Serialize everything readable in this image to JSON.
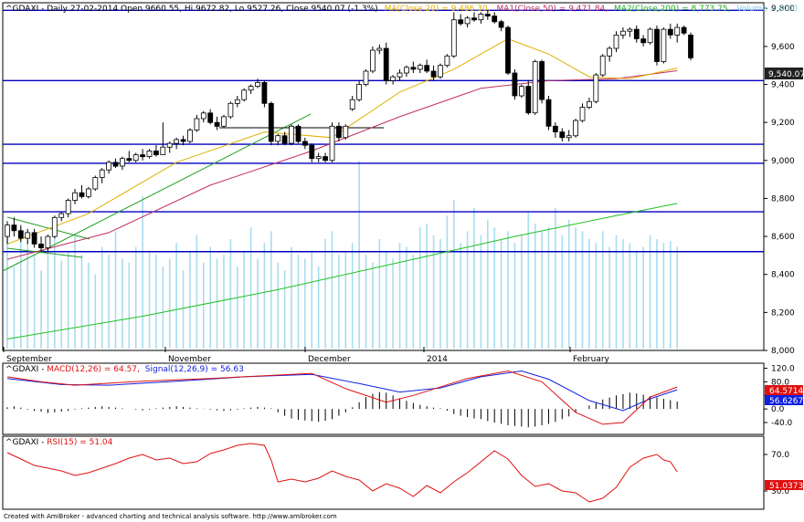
{
  "header": {
    "symbol_line": "^GDAXI - Daily 27-02-2014 Open 9660.55, Hi 9672.82, Lo 9527.26, Close 9540.07 (-1.3%)",
    "ma20": "MA(Close,20) = 9,486.30,",
    "ma50": "MA1(Close,50) = 9,471.84,",
    "ma200": "MA2(Close,200) = 8,773.75,",
    "volume": "Volume = 0.00"
  },
  "macd_header": {
    "prefix": "^GDAXI - ",
    "macd": "MACD(12,26) = 64.57,",
    "signal": "Signal(12,26,9) = 56.63"
  },
  "rsi_header": {
    "prefix": "^GDAXI - ",
    "rsi": "RSI(15) = 51.04"
  },
  "footer": "Created with AmiBroker - advanced charting and technical analysis software. http://www.amibroker.com",
  "colors": {
    "ma20": "#e0b000",
    "ma50": "#c03060",
    "ma200": "#20c020",
    "volume": "#a8dcf0",
    "hlines": "#0000c0",
    "macd": "#e01010",
    "signal": "#1020e0",
    "rsi": "#e01010",
    "trend": "#20a020"
  },
  "chart_data": [
    {
      "type": "candlestick",
      "yticks": [
        "9,800",
        "9,600",
        "9,400",
        "9,200",
        "9,000",
        "8,800",
        "8,600",
        "8,400",
        "8,200",
        "8,000"
      ],
      "ylim": [
        8000,
        9830
      ],
      "xlabels": [
        "September",
        "November",
        "December",
        "2014",
        "February"
      ],
      "last_value_label": "9,540.07",
      "horizontal_levels": [
        9790,
        9420,
        9085,
        8985,
        8730,
        8520
      ],
      "candles": [
        [
          8600,
          8680,
          8560,
          8660
        ],
        [
          8660,
          8700,
          8600,
          8630
        ],
        [
          8630,
          8660,
          8570,
          8590
        ],
        [
          8590,
          8640,
          8560,
          8620
        ],
        [
          8620,
          8640,
          8540,
          8560
        ],
        [
          8560,
          8600,
          8520,
          8540
        ],
        [
          8540,
          8610,
          8520,
          8600
        ],
        [
          8600,
          8710,
          8590,
          8700
        ],
        [
          8700,
          8730,
          8680,
          8720
        ],
        [
          8720,
          8800,
          8700,
          8790
        ],
        [
          8790,
          8850,
          8770,
          8830
        ],
        [
          8830,
          8870,
          8800,
          8810
        ],
        [
          8810,
          8860,
          8800,
          8850
        ],
        [
          8850,
          8920,
          8840,
          8910
        ],
        [
          8910,
          8960,
          8880,
          8950
        ],
        [
          8950,
          9000,
          8930,
          8990
        ],
        [
          8990,
          9010,
          8960,
          8970
        ],
        [
          8970,
          9020,
          8950,
          9010
        ],
        [
          9010,
          9050,
          8990,
          9000
        ],
        [
          9000,
          9040,
          8990,
          9030
        ],
        [
          9030,
          9060,
          9000,
          9020
        ],
        [
          9020,
          9060,
          9010,
          9050
        ],
        [
          9050,
          9080,
          9020,
          9030
        ],
        [
          9030,
          9200,
          9030,
          9070
        ],
        [
          9070,
          9100,
          9040,
          9090
        ],
        [
          9090,
          9120,
          9060,
          9110
        ],
        [
          9110,
          9130,
          9080,
          9100
        ],
        [
          9100,
          9170,
          9090,
          9160
        ],
        [
          9160,
          9240,
          9150,
          9220
        ],
        [
          9220,
          9260,
          9200,
          9250
        ],
        [
          9250,
          9270,
          9190,
          9200
        ],
        [
          9200,
          9230,
          9160,
          9180
        ],
        [
          9180,
          9240,
          9170,
          9230
        ],
        [
          9230,
          9310,
          9220,
          9300
        ],
        [
          9300,
          9340,
          9280,
          9320
        ],
        [
          9320,
          9380,
          9310,
          9370
        ],
        [
          9370,
          9400,
          9350,
          9390
        ],
        [
          9390,
          9430,
          9380,
          9410
        ],
        [
          9410,
          9420,
          9280,
          9300
        ],
        [
          9300,
          9310,
          9080,
          9100
        ],
        [
          9100,
          9140,
          9080,
          9130
        ],
        [
          9130,
          9150,
          9080,
          9090
        ],
        [
          9090,
          9190,
          9080,
          9180
        ],
        [
          9180,
          9190,
          9090,
          9100
        ],
        [
          9100,
          9120,
          9060,
          9080
        ],
        [
          9080,
          9090,
          8990,
          9010
        ],
        [
          9010,
          9040,
          8990,
          9020
        ],
        [
          9020,
          9040,
          8990,
          9000
        ],
        [
          9000,
          9200,
          8990,
          9180
        ],
        [
          9180,
          9200,
          9100,
          9120
        ],
        [
          9120,
          9190,
          9110,
          9180
        ],
        [
          9270,
          9340,
          9260,
          9320
        ],
        [
          9320,
          9420,
          9310,
          9400
        ],
        [
          9400,
          9480,
          9390,
          9470
        ],
        [
          9470,
          9600,
          9460,
          9580
        ],
        [
          9580,
          9610,
          9560,
          9590
        ],
        [
          9590,
          9620,
          9400,
          9420
        ],
        [
          9420,
          9450,
          9400,
          9440
        ],
        [
          9440,
          9480,
          9420,
          9460
        ],
        [
          9460,
          9500,
          9440,
          9490
        ],
        [
          9490,
          9520,
          9460,
          9480
        ],
        [
          9480,
          9510,
          9460,
          9500
        ],
        [
          9500,
          9530,
          9460,
          9470
        ],
        [
          9470,
          9500,
          9420,
          9440
        ],
        [
          9440,
          9510,
          9430,
          9500
        ],
        [
          9500,
          9560,
          9490,
          9550
        ],
        [
          9550,
          9780,
          9540,
          9740
        ],
        [
          9740,
          9770,
          9710,
          9720
        ],
        [
          9720,
          9760,
          9700,
          9750
        ],
        [
          9750,
          9780,
          9730,
          9740
        ],
        [
          9740,
          9780,
          9720,
          9770
        ],
        [
          9770,
          9790,
          9740,
          9760
        ],
        [
          9760,
          9780,
          9720,
          9730
        ],
        [
          9730,
          9740,
          9680,
          9700
        ],
        [
          9700,
          9710,
          9450,
          9460
        ],
        [
          9460,
          9480,
          9320,
          9340
        ],
        [
          9340,
          9400,
          9330,
          9390
        ],
        [
          9390,
          9420,
          9240,
          9250
        ],
        [
          9250,
          9530,
          9240,
          9520
        ],
        [
          9520,
          9530,
          9300,
          9320
        ],
        [
          9320,
          9340,
          9160,
          9180
        ],
        [
          9180,
          9200,
          9120,
          9150
        ],
        [
          9150,
          9170,
          9100,
          9120
        ],
        [
          9120,
          9160,
          9100,
          9130
        ],
        [
          9130,
          9220,
          9120,
          9210
        ],
        [
          9210,
          9300,
          9200,
          9280
        ],
        [
          9280,
          9330,
          9270,
          9310
        ],
        [
          9310,
          9460,
          9300,
          9450
        ],
        [
          9450,
          9560,
          9440,
          9550
        ],
        [
          9550,
          9600,
          9520,
          9590
        ],
        [
          9590,
          9680,
          9570,
          9660
        ],
        [
          9660,
          9700,
          9640,
          9680
        ],
        [
          9680,
          9700,
          9650,
          9690
        ],
        [
          9690,
          9710,
          9620,
          9640
        ],
        [
          9640,
          9660,
          9600,
          9620
        ],
        [
          9620,
          9700,
          9610,
          9690
        ],
        [
          9690,
          9710,
          9500,
          9520
        ],
        [
          9520,
          9700,
          9510,
          9690
        ],
        [
          9690,
          9720,
          9640,
          9660
        ],
        [
          9660,
          9720,
          9620,
          9700
        ],
        [
          9700,
          9710,
          9660,
          9670
        ],
        [
          9660,
          9673,
          9527,
          9540
        ]
      ],
      "ma20": [
        [
          0,
          8560
        ],
        [
          12,
          8720
        ],
        [
          25,
          8990
        ],
        [
          38,
          9150
        ],
        [
          48,
          9120
        ],
        [
          58,
          9360
        ],
        [
          66,
          9480
        ],
        [
          74,
          9640
        ],
        [
          80,
          9560
        ],
        [
          86,
          9440
        ],
        [
          92,
          9430
        ],
        [
          99,
          9486
        ]
      ],
      "ma50": [
        [
          0,
          8480
        ],
        [
          15,
          8620
        ],
        [
          30,
          8870
        ],
        [
          45,
          9050
        ],
        [
          58,
          9230
        ],
        [
          70,
          9380
        ],
        [
          80,
          9420
        ],
        [
          90,
          9430
        ],
        [
          99,
          9472
        ]
      ],
      "ma200": [
        [
          0,
          8060
        ],
        [
          20,
          8180
        ],
        [
          40,
          8320
        ],
        [
          60,
          8480
        ],
        [
          75,
          8600
        ],
        [
          90,
          8710
        ],
        [
          99,
          8774
        ]
      ],
      "volume": [
        58,
        42,
        62,
        55,
        48,
        40,
        54,
        66,
        45,
        50,
        58,
        48,
        44,
        38,
        52,
        48,
        60,
        46,
        44,
        52,
        78,
        50,
        48,
        42,
        46,
        54,
        40,
        50,
        58,
        44,
        52,
        46,
        48,
        56,
        42,
        50,
        62,
        46,
        54,
        60,
        44,
        40,
        52,
        48,
        46,
        50,
        42,
        56,
        60,
        48,
        50,
        54,
        96,
        48,
        44,
        56,
        50,
        46,
        54,
        52,
        48,
        62,
        64,
        58,
        56,
        68,
        76,
        54,
        60,
        72,
        58,
        66,
        62,
        56,
        60,
        54,
        58,
        70,
        64,
        60,
        62,
        72,
        58,
        66,
        62,
        60,
        56,
        54,
        60,
        52,
        58,
        56,
        54,
        50,
        52,
        58,
        56,
        54,
        55,
        52
      ]
    },
    {
      "type": "line",
      "name": "MACD",
      "yticks": [
        "120.0",
        "80.0",
        "40.0",
        "0.0",
        "-40.0"
      ],
      "ylim": [
        -75,
        135
      ],
      "macd_label": "64.5714",
      "signal_label": "56.6267",
      "macd": [
        [
          0,
          95
        ],
        [
          5,
          80
        ],
        [
          10,
          70
        ],
        [
          20,
          82
        ],
        [
          30,
          90
        ],
        [
          40,
          100
        ],
        [
          45,
          105
        ],
        [
          50,
          60
        ],
        [
          56,
          20
        ],
        [
          60,
          40
        ],
        [
          68,
          90
        ],
        [
          74,
          112
        ],
        [
          79,
          80
        ],
        [
          84,
          -10
        ],
        [
          88,
          -45
        ],
        [
          91,
          -40
        ],
        [
          95,
          35
        ],
        [
          99,
          64.6
        ]
      ],
      "signal": [
        [
          0,
          90
        ],
        [
          8,
          72
        ],
        [
          15,
          70
        ],
        [
          25,
          82
        ],
        [
          35,
          95
        ],
        [
          45,
          102
        ],
        [
          52,
          75
        ],
        [
          58,
          50
        ],
        [
          64,
          62
        ],
        [
          70,
          95
        ],
        [
          76,
          112
        ],
        [
          80,
          88
        ],
        [
          86,
          25
        ],
        [
          91,
          -5
        ],
        [
          95,
          30
        ],
        [
          99,
          56.6
        ]
      ],
      "histogram": [
        5,
        8,
        4,
        -2,
        -6,
        -8,
        -12,
        -10,
        -8,
        -6,
        -2,
        2,
        4,
        6,
        8,
        6,
        4,
        2,
        0,
        -2,
        -4,
        -2,
        2,
        4,
        6,
        8,
        6,
        4,
        2,
        1,
        -2,
        -4,
        -6,
        -4,
        -2,
        2,
        4,
        6,
        4,
        2,
        -10,
        -20,
        -28,
        -32,
        -34,
        -36,
        -38,
        -35,
        -30,
        -20,
        -10,
        5,
        20,
        35,
        45,
        50,
        48,
        40,
        32,
        24,
        18,
        12,
        8,
        4,
        2,
        -5,
        -15,
        -20,
        -24,
        -28,
        -30,
        -36,
        -40,
        -44,
        -48,
        -50,
        -52,
        -54,
        -52,
        -48,
        -44,
        -38,
        -30,
        -22,
        -10,
        0,
        10,
        20,
        28,
        34,
        40,
        44,
        48,
        46,
        42,
        38,
        34,
        30,
        26,
        22
      ]
    },
    {
      "type": "line",
      "name": "RSI",
      "yticks": [
        "70.0",
        "30.0"
      ],
      "ylim": [
        10,
        90
      ],
      "rsi_label": "51.0373",
      "rsi": [
        [
          0,
          72
        ],
        [
          2,
          65
        ],
        [
          4,
          58
        ],
        [
          6,
          55
        ],
        [
          8,
          52
        ],
        [
          10,
          47
        ],
        [
          12,
          50
        ],
        [
          14,
          55
        ],
        [
          16,
          60
        ],
        [
          18,
          66
        ],
        [
          20,
          70
        ],
        [
          22,
          64
        ],
        [
          24,
          66
        ],
        [
          26,
          60
        ],
        [
          28,
          62
        ],
        [
          30,
          71
        ],
        [
          32,
          75
        ],
        [
          34,
          80
        ],
        [
          36,
          82
        ],
        [
          38,
          80
        ],
        [
          39,
          64
        ],
        [
          40,
          40
        ],
        [
          42,
          43
        ],
        [
          44,
          40
        ],
        [
          46,
          44
        ],
        [
          48,
          52
        ],
        [
          50,
          46
        ],
        [
          52,
          42
        ],
        [
          54,
          30
        ],
        [
          56,
          38
        ],
        [
          58,
          33
        ],
        [
          60,
          24
        ],
        [
          62,
          36
        ],
        [
          64,
          28
        ],
        [
          66,
          40
        ],
        [
          68,
          50
        ],
        [
          70,
          62
        ],
        [
          72,
          74
        ],
        [
          74,
          65
        ],
        [
          76,
          47
        ],
        [
          78,
          35
        ],
        [
          80,
          38
        ],
        [
          82,
          30
        ],
        [
          84,
          28
        ],
        [
          86,
          18
        ],
        [
          88,
          22
        ],
        [
          90,
          34
        ],
        [
          92,
          56
        ],
        [
          94,
          66
        ],
        [
          96,
          70
        ],
        [
          97,
          64
        ],
        [
          98,
          62
        ],
        [
          99,
          51
        ]
      ]
    }
  ]
}
